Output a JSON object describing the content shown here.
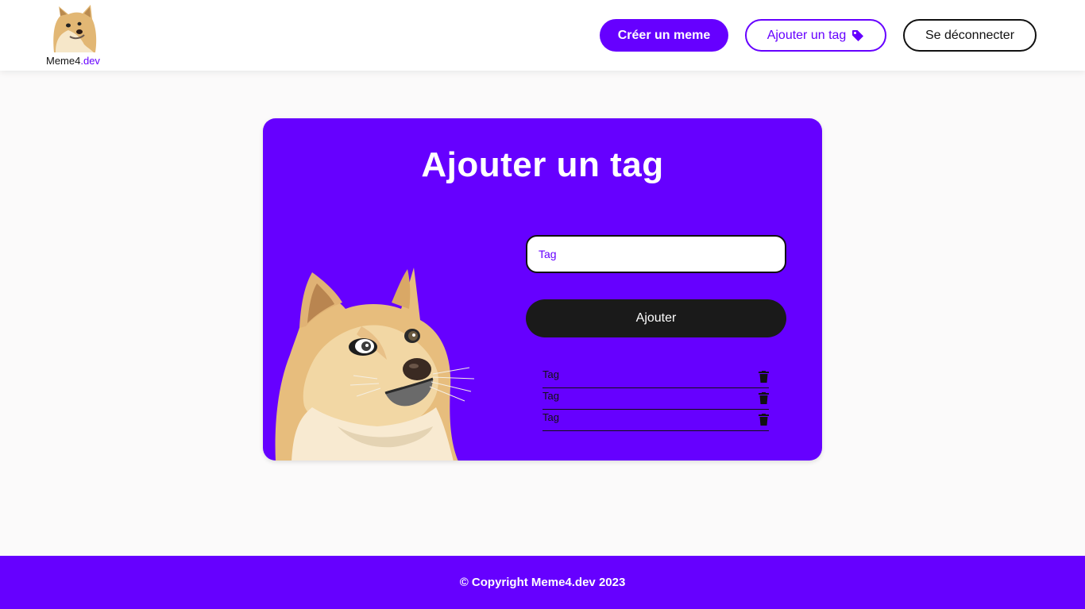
{
  "header": {
    "logo": {
      "name": "Meme4",
      "accent": ".dev",
      "icon": "doge-logo"
    },
    "buttons": {
      "create_meme": "Créer un meme",
      "add_tag": "Ajouter un tag",
      "add_tag_icon": "tag-icon",
      "logout": "Se déconnecter"
    }
  },
  "card": {
    "title": "Ajouter un tag",
    "input": {
      "placeholder": "Tag",
      "value": ""
    },
    "submit_label": "Ajouter",
    "illustration": "doge-illustration",
    "tags": [
      {
        "name": "Tag",
        "delete_icon": "trash-icon"
      },
      {
        "name": "Tag",
        "delete_icon": "trash-icon"
      },
      {
        "name": "Tag",
        "delete_icon": "trash-icon"
      }
    ]
  },
  "footer": {
    "text": "© Copyright Meme4.dev 2023"
  },
  "colors": {
    "accent": "#6600ff",
    "dark": "#1a1a1a",
    "background": "#fbfafa"
  }
}
